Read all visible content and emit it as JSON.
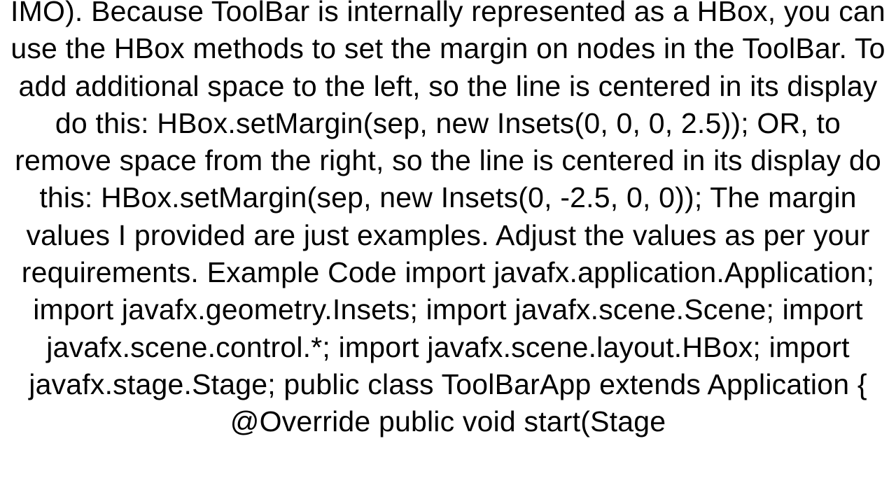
{
  "body": {
    "text": "IMO). Because ToolBar is internally represented as a HBox, you can use the HBox methods to set the margin on nodes in the ToolBar. To add additional space to the left, so the line is centered in its display do this: HBox.setMargin(sep, new Insets(0, 0, 0, 2.5));  OR, to remove space from the right, so the line is centered in its display do this: HBox.setMargin(sep, new Insets(0, -2.5, 0, 0));  The margin values I provided are just examples.  Adjust the values as per your requirements. Example Code  import javafx.application.Application; import javafx.geometry.Insets; import javafx.scene.Scene; import javafx.scene.control.*; import javafx.scene.layout.HBox; import javafx.stage.Stage;  public class ToolBarApp extends Application {     @Override     public void start(Stage"
  }
}
